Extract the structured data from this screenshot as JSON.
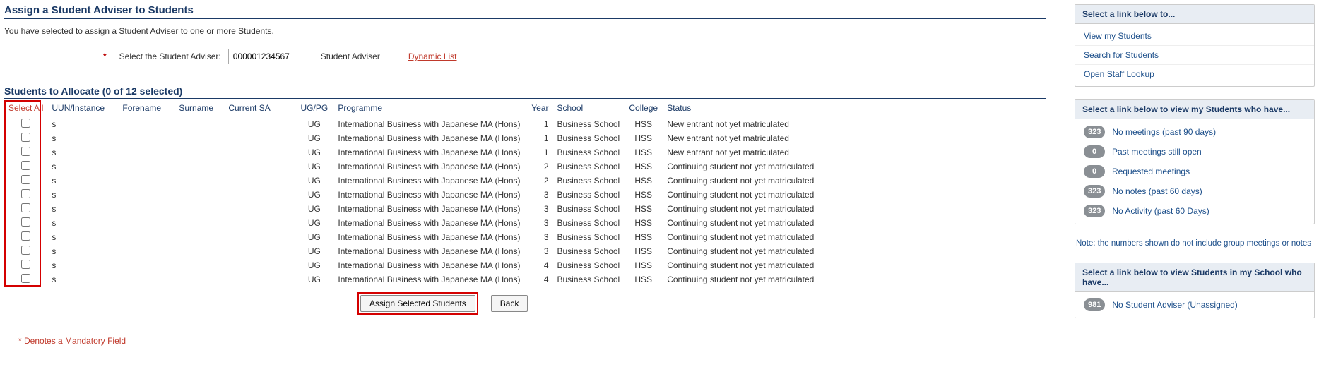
{
  "header": {
    "title": "Assign a Student Adviser to Students",
    "intro": "You have selected to assign a Student Adviser to one or more Students."
  },
  "adviser_form": {
    "label": "Select the Student Adviser:",
    "value": "000001234567",
    "role_text": "Student Adviser",
    "dynamic_list_label": "Dynamic List"
  },
  "allocation": {
    "section_title": "Students to Allocate (0 of 12 selected)",
    "select_all_label": "Select All",
    "columns": {
      "uun": "UUN/Instance",
      "forename": "Forename",
      "surname": "Surname",
      "current_sa": "Current SA",
      "ugpg": "UG/PG",
      "programme": "Programme",
      "year": "Year",
      "school": "School",
      "college": "College",
      "status": "Status"
    },
    "rows": [
      {
        "uun": "s",
        "forename": "",
        "surname": "",
        "current_sa": "",
        "ugpg": "UG",
        "programme": "International Business with Japanese MA (Hons)",
        "year": "1",
        "school": "Business School",
        "college": "HSS",
        "status": "New entrant not yet matriculated"
      },
      {
        "uun": "s",
        "forename": "",
        "surname": "",
        "current_sa": "",
        "ugpg": "UG",
        "programme": "International Business with Japanese MA (Hons)",
        "year": "1",
        "school": "Business School",
        "college": "HSS",
        "status": "New entrant not yet matriculated"
      },
      {
        "uun": "s",
        "forename": "",
        "surname": "",
        "current_sa": "",
        "ugpg": "UG",
        "programme": "International Business with Japanese MA (Hons)",
        "year": "1",
        "school": "Business School",
        "college": "HSS",
        "status": "New entrant not yet matriculated"
      },
      {
        "uun": "s",
        "forename": "",
        "surname": "",
        "current_sa": "",
        "ugpg": "UG",
        "programme": "International Business with Japanese MA (Hons)",
        "year": "2",
        "school": "Business School",
        "college": "HSS",
        "status": "Continuing student not yet matriculated"
      },
      {
        "uun": "s",
        "forename": "",
        "surname": "",
        "current_sa": "",
        "ugpg": "UG",
        "programme": "International Business with Japanese MA (Hons)",
        "year": "2",
        "school": "Business School",
        "college": "HSS",
        "status": "Continuing student not yet matriculated"
      },
      {
        "uun": "s",
        "forename": "",
        "surname": "",
        "current_sa": "",
        "ugpg": "UG",
        "programme": "International Business with Japanese MA (Hons)",
        "year": "3",
        "school": "Business School",
        "college": "HSS",
        "status": "Continuing student not yet matriculated"
      },
      {
        "uun": "s",
        "forename": "",
        "surname": "",
        "current_sa": "",
        "ugpg": "UG",
        "programme": "International Business with Japanese MA (Hons)",
        "year": "3",
        "school": "Business School",
        "college": "HSS",
        "status": "Continuing student not yet matriculated"
      },
      {
        "uun": "s",
        "forename": "",
        "surname": "",
        "current_sa": "",
        "ugpg": "UG",
        "programme": "International Business with Japanese MA (Hons)",
        "year": "3",
        "school": "Business School",
        "college": "HSS",
        "status": "Continuing student not yet matriculated"
      },
      {
        "uun": "s",
        "forename": "",
        "surname": "",
        "current_sa": "",
        "ugpg": "UG",
        "programme": "International Business with Japanese MA (Hons)",
        "year": "3",
        "school": "Business School",
        "college": "HSS",
        "status": "Continuing student not yet matriculated"
      },
      {
        "uun": "s",
        "forename": "",
        "surname": "",
        "current_sa": "",
        "ugpg": "UG",
        "programme": "International Business with Japanese MA (Hons)",
        "year": "3",
        "school": "Business School",
        "college": "HSS",
        "status": "Continuing student not yet matriculated"
      },
      {
        "uun": "s",
        "forename": "",
        "surname": "",
        "current_sa": "",
        "ugpg": "UG",
        "programme": "International Business with Japanese MA (Hons)",
        "year": "4",
        "school": "Business School",
        "college": "HSS",
        "status": "Continuing student not yet matriculated"
      },
      {
        "uun": "s",
        "forename": "",
        "surname": "",
        "current_sa": "",
        "ugpg": "UG",
        "programme": "International Business with Japanese MA (Hons)",
        "year": "4",
        "school": "Business School",
        "college": "HSS",
        "status": "Continuing student not yet matriculated"
      }
    ],
    "assign_button": "Assign Selected Students",
    "back_button": "Back"
  },
  "mandatory_note": "* Denotes a Mandatory Field",
  "sidebar": {
    "links_panel": {
      "header": "Select a link below to...",
      "items": [
        {
          "label": "View my Students"
        },
        {
          "label": "Search for Students"
        },
        {
          "label": "Open Staff Lookup"
        }
      ]
    },
    "my_students_panel": {
      "header": "Select a link below to view my Students who have...",
      "items": [
        {
          "count": "323",
          "label": "No meetings (past 90 days)"
        },
        {
          "count": "0",
          "label": "Past meetings still open"
        },
        {
          "count": "0",
          "label": "Requested meetings"
        },
        {
          "count": "323",
          "label": "No notes (past 60 days)"
        },
        {
          "count": "323",
          "label": "No Activity (past 60 Days)"
        }
      ],
      "footer_note": "Note: the numbers shown do not include group meetings or notes"
    },
    "school_panel": {
      "header": "Select a link below to view Students in my School who have...",
      "items": [
        {
          "count": "981",
          "label": "No Student Adviser (Unassigned)"
        }
      ]
    }
  }
}
